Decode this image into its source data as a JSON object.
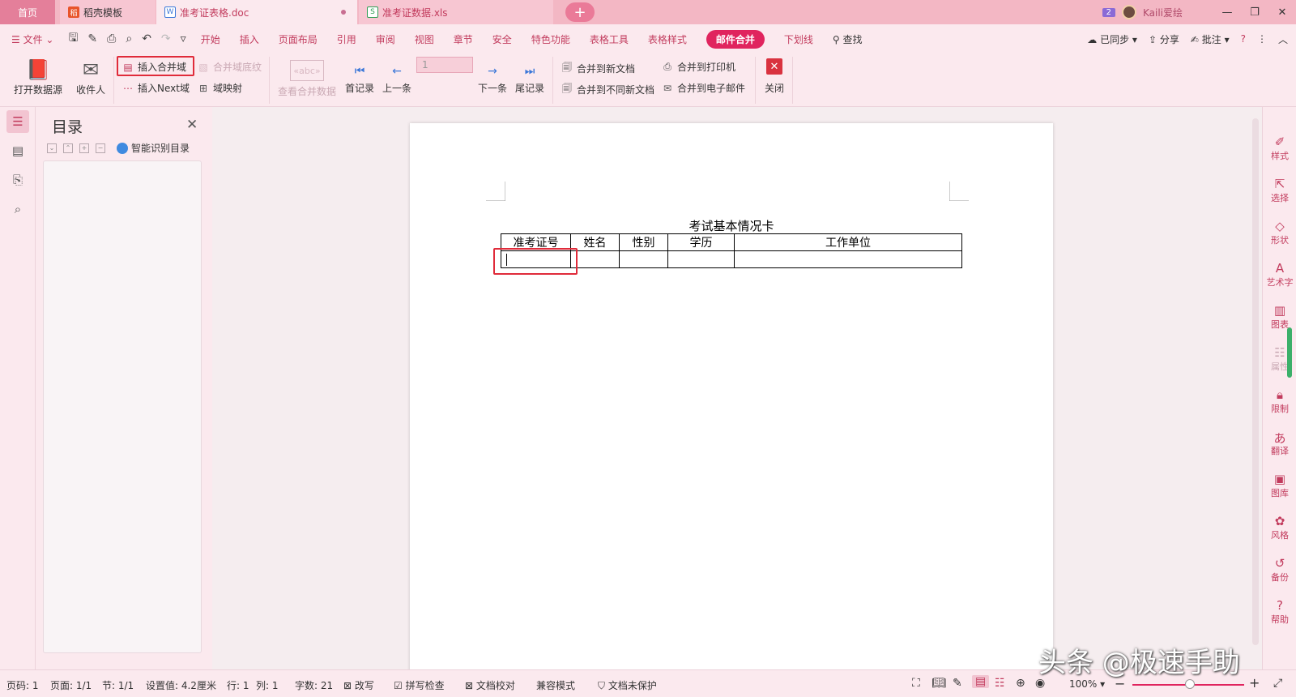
{
  "tabs": {
    "home": "首页",
    "template": "稻壳模板",
    "doc": "准考证表格.doc",
    "xls": "准考证数据.xls"
  },
  "user": {
    "badge": "2",
    "name": "Kaili爱绘"
  },
  "menu": {
    "file": "文件",
    "items": [
      "开始",
      "插入",
      "页面布局",
      "引用",
      "审阅",
      "视图",
      "章节",
      "安全",
      "特色功能",
      "表格工具",
      "表格样式",
      "邮件合并",
      "下划线"
    ],
    "search": "查找",
    "sync": "已同步",
    "share": "分享",
    "comment": "批注"
  },
  "ribbon": {
    "open_source": "打开数据源",
    "recipients": "收件人",
    "insert_merge_field": "插入合并域",
    "merge_field_shading": "合并域底纹",
    "insert_next": "插入Next域",
    "field_mapping": "域映射",
    "view_merge_data": "查看合并数据",
    "first": "首记录",
    "prev": "上一条",
    "record_value": "1",
    "next": "下一条",
    "last": "尾记录",
    "merge_new_doc": "合并到新文档",
    "merge_diff_doc": "合并到不同新文档",
    "merge_printer": "合并到打印机",
    "merge_email": "合并到电子邮件",
    "close": "关闭"
  },
  "toc": {
    "title": "目录",
    "smart": "智能识别目录"
  },
  "document": {
    "title": "考试基本情况卡",
    "headers": [
      "准考证号",
      "姓名",
      "性别",
      "学历",
      "工作单位"
    ]
  },
  "rightbar": [
    "样式",
    "选择",
    "形状",
    "艺术字",
    "图表",
    "属性",
    "限制",
    "翻译",
    "图库",
    "风格",
    "备份",
    "帮助"
  ],
  "status": {
    "page_code": "页码: 1",
    "page": "页面: 1/1",
    "section": "节: 1/1",
    "setting": "设置值: 4.2厘米",
    "row": "行: 1",
    "col": "列: 1",
    "words": "字数: 21",
    "revise": "改写",
    "spell": "拼写检查",
    "proof": "文档校对",
    "compat": "兼容模式",
    "protect": "文档未保护",
    "zoom": "100%"
  },
  "watermark": "头条 @极速手助",
  "colors": {
    "accent": "#e0245e",
    "tabbar": "#f3b7c4",
    "ribbon": "#fbe9ee",
    "highlight_box": "#e02b3a"
  }
}
